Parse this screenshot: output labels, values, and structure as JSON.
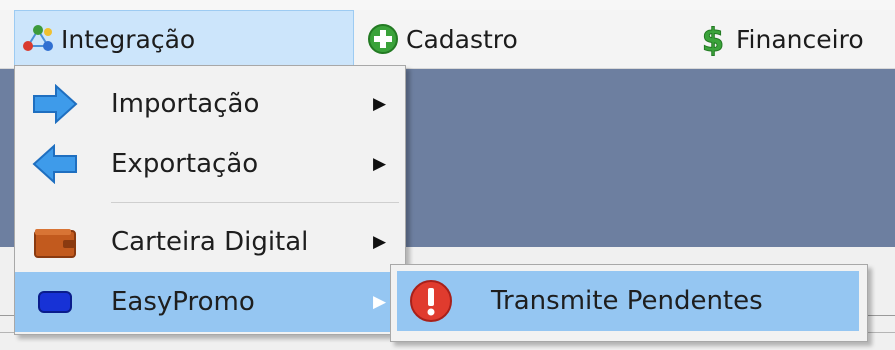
{
  "menubar": {
    "items": [
      {
        "label": "Integração",
        "icon": "network-icon"
      },
      {
        "label": "Cadastro",
        "icon": "plus-circle-icon"
      },
      {
        "label": "Financeiro",
        "icon": "dollar-icon"
      }
    ]
  },
  "dropdown": {
    "items": [
      {
        "label": "Importação",
        "icon": "arrow-right-icon",
        "has_submenu": true
      },
      {
        "label": "Exportação",
        "icon": "arrow-left-icon",
        "has_submenu": true
      },
      {
        "label": "Carteira Digital",
        "icon": "wallet-icon",
        "has_submenu": true
      },
      {
        "label": "EasyPromo",
        "icon": "blue-box-icon",
        "has_submenu": true,
        "selected": true
      }
    ]
  },
  "submenu": {
    "items": [
      {
        "label": "Transmite Pendentes",
        "icon": "alert-icon"
      }
    ]
  },
  "colors": {
    "menu_highlight": "#95c6f2",
    "workspace": "#6d7fa0",
    "alert_red": "#e03b2e"
  }
}
